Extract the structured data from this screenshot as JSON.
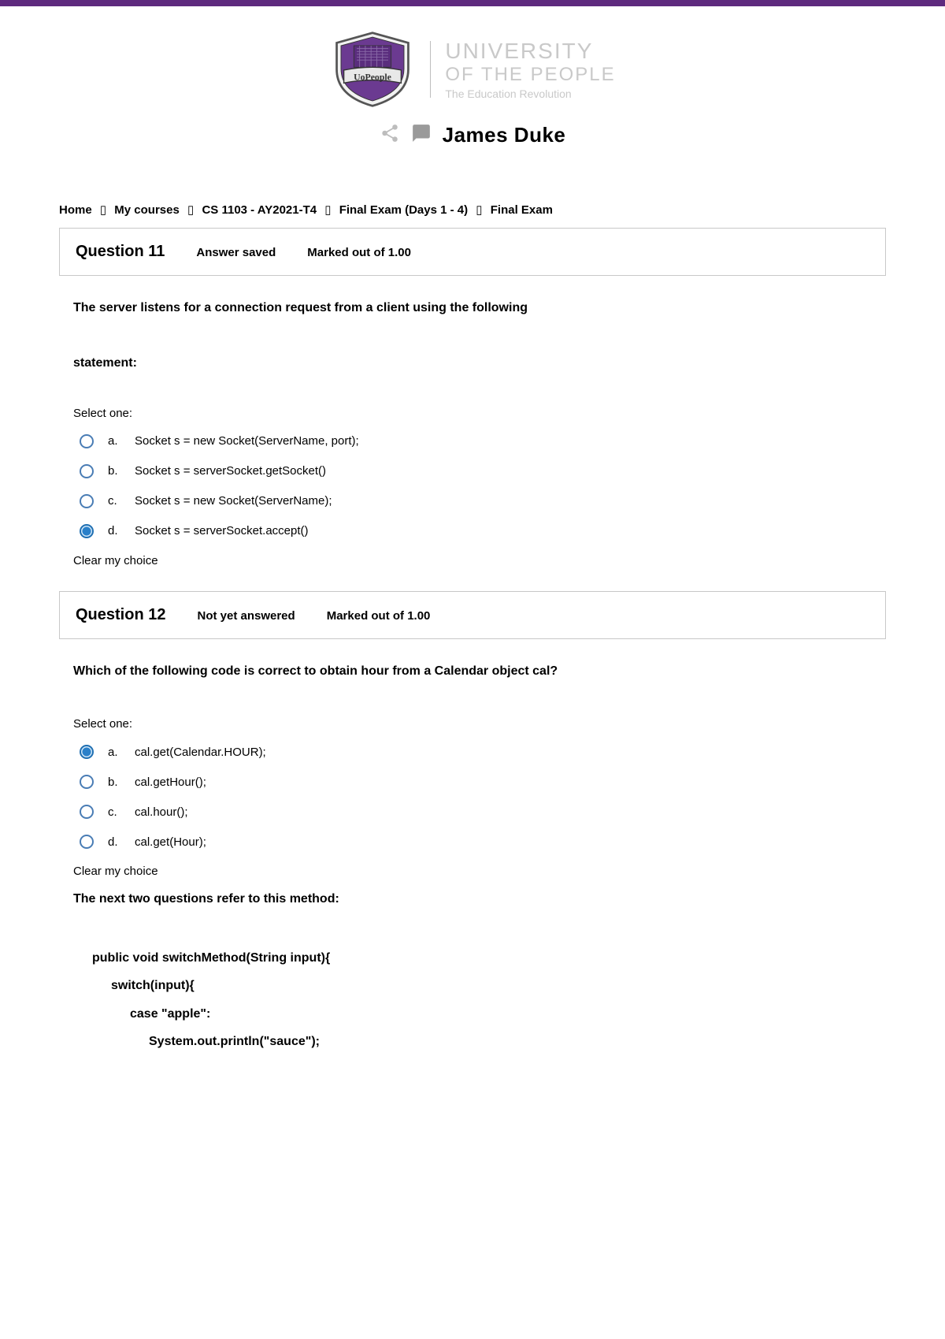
{
  "header": {
    "university_line1": "UNIVERSITY",
    "university_line2": "OF THE PEOPLE",
    "university_line3": "The Education Revolution",
    "shield_text": "UoPeople",
    "author": "James Duke"
  },
  "breadcrumb": {
    "items": [
      "Home",
      "My courses",
      "CS 1103 - AY2021-T4",
      "Final Exam (Days 1 - 4)",
      "Final Exam"
    ]
  },
  "q11": {
    "title": "Question 11",
    "status": "Answer saved",
    "marks": "Marked out of 1.00",
    "text_line1": "The server listens for a connection request from a client using the following",
    "text_line2": "statement:",
    "select_one": "Select one:",
    "options": [
      {
        "letter": "a.",
        "text": "Socket s = new Socket(ServerName, port);",
        "selected": false
      },
      {
        "letter": "b.",
        "text": "Socket s = serverSocket.getSocket()",
        "selected": false
      },
      {
        "letter": "c.",
        "text": "Socket s = new Socket(ServerName);",
        "selected": false
      },
      {
        "letter": "d.",
        "text": "Socket s = serverSocket.accept()",
        "selected": true
      }
    ],
    "clear": "Clear my choice"
  },
  "q12": {
    "title": "Question 12",
    "status": "Not yet answered",
    "marks": "Marked out of 1.00",
    "text": "Which of the following code is correct to obtain hour from a Calendar object cal?",
    "select_one": "Select one:",
    "options": [
      {
        "letter": "a.",
        "text": "cal.get(Calendar.HOUR);",
        "selected": true
      },
      {
        "letter": "b.",
        "text": "cal.getHour();",
        "selected": false
      },
      {
        "letter": "c.",
        "text": "cal.hour();",
        "selected": false
      },
      {
        "letter": "d.",
        "text": "cal.get(Hour);",
        "selected": false
      }
    ],
    "clear": "Clear my choice",
    "refer": "The next two questions refer to this method:",
    "code": [
      {
        "indent": 0,
        "text": "public void switchMethod(String input){"
      },
      {
        "indent": 1,
        "text": "switch(input){"
      },
      {
        "indent": 2,
        "text": "case \"apple\":"
      },
      {
        "indent": 3,
        "text": "System.out.println(\"sauce\");"
      }
    ]
  }
}
